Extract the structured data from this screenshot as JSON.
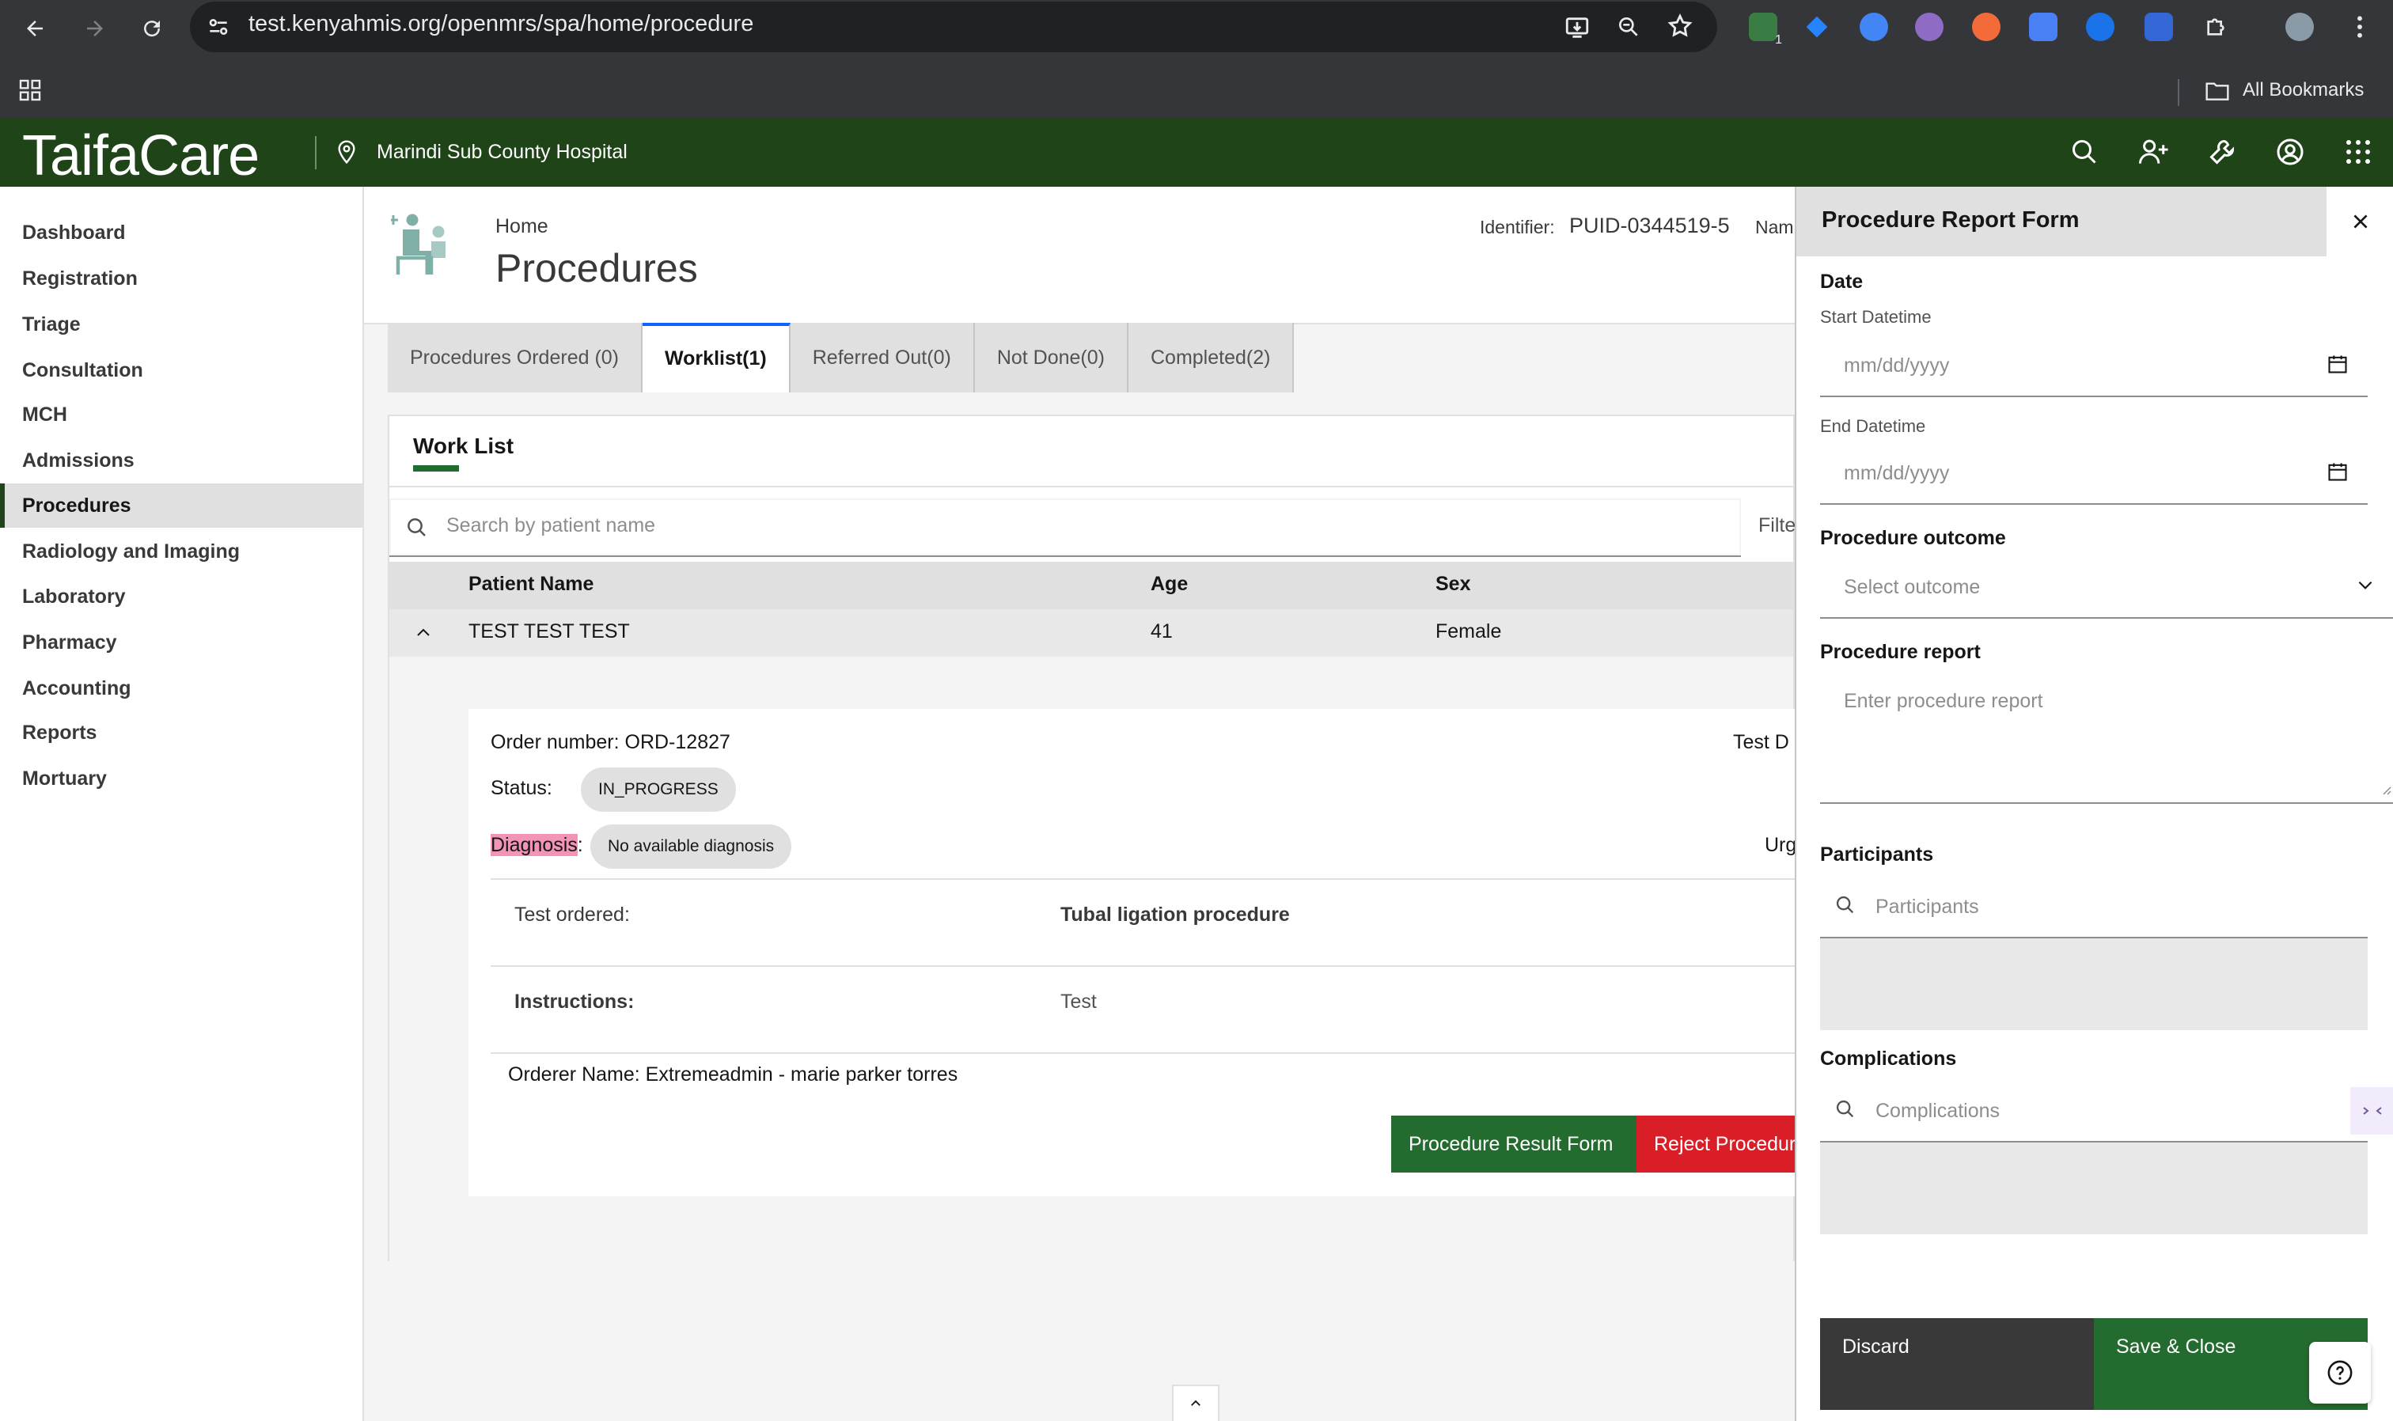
{
  "browser": {
    "url": "test.kenyahmis.org/openmrs/spa/home/procedure",
    "extension_badge": "1",
    "bookmarks_label": "All Bookmarks"
  },
  "app": {
    "logo_text": "TaifaCare",
    "location": "Marindi Sub County Hospital",
    "brand_color": "#1f4418"
  },
  "sidebar": {
    "items": [
      {
        "label": "Dashboard"
      },
      {
        "label": "Registration"
      },
      {
        "label": "Triage"
      },
      {
        "label": "Consultation"
      },
      {
        "label": "MCH"
      },
      {
        "label": "Admissions"
      },
      {
        "label": "Procedures",
        "active": true
      },
      {
        "label": "Radiology and Imaging"
      },
      {
        "label": "Laboratory"
      },
      {
        "label": "Pharmacy"
      },
      {
        "label": "Accounting"
      },
      {
        "label": "Reports"
      },
      {
        "label": "Mortuary"
      }
    ]
  },
  "page": {
    "breadcrumb": "Home",
    "title": "Procedures",
    "identifier_label": "Identifier:",
    "identifier_value": "PUID-0344519-5",
    "name_label_partial": "Nam"
  },
  "tabs": [
    {
      "label": "Procedures Ordered (0)"
    },
    {
      "label": "Worklist(1)",
      "active": true
    },
    {
      "label": "Referred Out(0)"
    },
    {
      "label": "Not Done(0)"
    },
    {
      "label": "Completed(2)"
    }
  ],
  "worklist": {
    "title": "Work List",
    "search_placeholder": "Search by patient name",
    "filter_partial": "Filte",
    "columns": [
      "Patient Name",
      "Age",
      "Sex"
    ],
    "row": {
      "name": "TEST TEST TEST",
      "age": "41",
      "sex": "Female"
    }
  },
  "order": {
    "order_number": "Order number: ORD-12827",
    "test_date_partial": "Test D",
    "status_label": "Status:",
    "status_value": "IN_PROGRESS",
    "diagnosis_label": "Diagnosis",
    "diagnosis_colon": ":",
    "diagnosis_value": "No available diagnosis",
    "urgency_partial": "Urg",
    "test_ordered_label": "Test ordered:",
    "test_ordered_value": "Tubal ligation procedure",
    "instructions_label": "Instructions:",
    "instructions_value": "Test",
    "orderer": "Orderer Name: Extremeadmin - marie parker torres",
    "result_form_button": "Procedure Result Form",
    "reject_button": "Reject Procedur"
  },
  "panel": {
    "title": "Procedure Report Form",
    "date_section": "Date",
    "start_label": "Start Datetime",
    "start_placeholder": "mm/dd/yyyy",
    "end_label": "End Datetime",
    "end_placeholder": "mm/dd/yyyy",
    "outcome_label": "Procedure outcome",
    "outcome_placeholder": "Select outcome",
    "report_label": "Procedure report",
    "report_placeholder": "Enter procedure report",
    "participants_label": "Participants",
    "participants_placeholder": "Participants",
    "complications_label": "Complications",
    "complications_placeholder": "Complications",
    "discard_button": "Discard",
    "save_button": "Save & Close"
  }
}
